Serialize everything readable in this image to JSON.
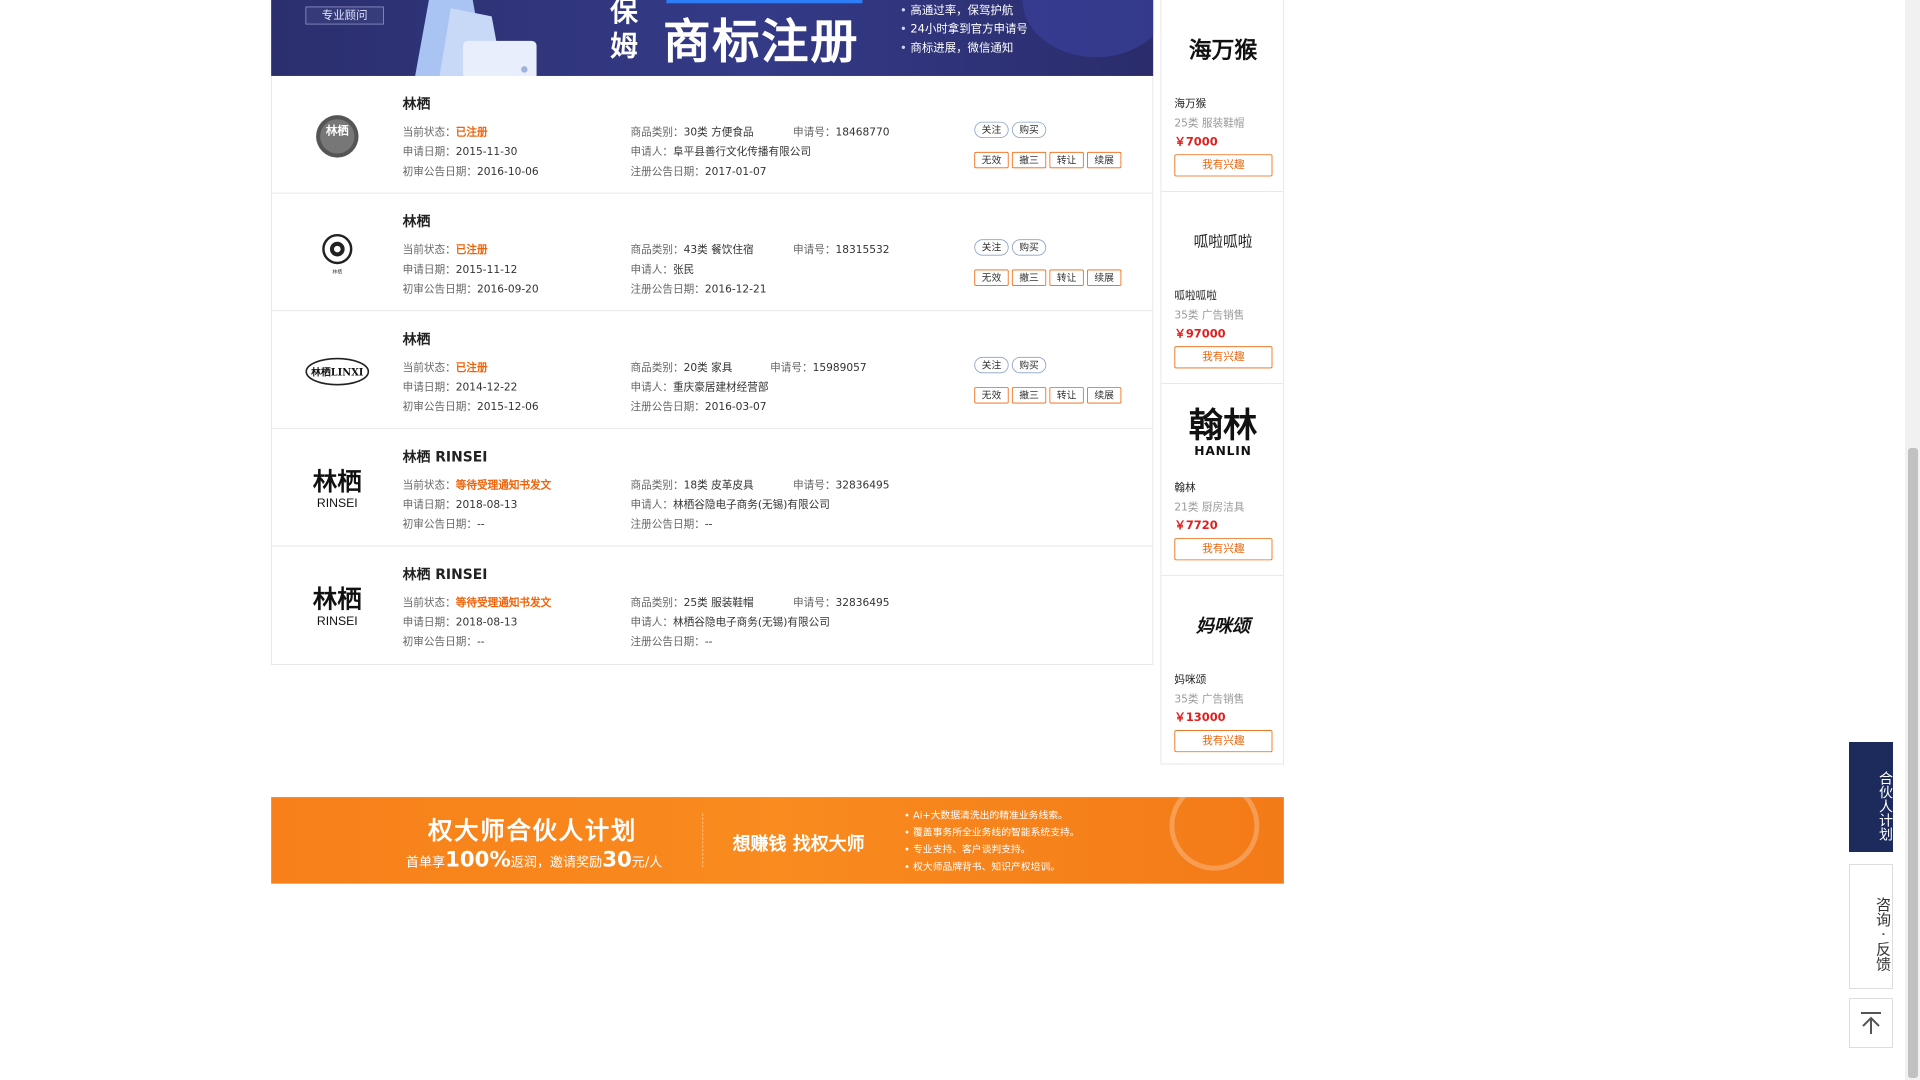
{
  "banner": {
    "consult_label": "专业顾问",
    "nanny": "保姆",
    "headline": "商标注册",
    "bullets": [
      "高通过率，保驾护航",
      "24小时拿到官方申请号",
      "商标进展，微信通知"
    ]
  },
  "labels": {
    "status": "当前状态：",
    "category": "商品类别：",
    "app_no": "申请号：",
    "app_date": "申请日期：",
    "applicant": "申请人：",
    "prelim_date": "初审公告日期：",
    "reg_date": "注册公告日期："
  },
  "actions": {
    "follow": "关注",
    "buy": "购买",
    "invalid": "无效",
    "revoke3": "撤三",
    "transfer": "转让",
    "renew": "续展"
  },
  "trademarks": [
    {
      "name": "林栖",
      "status": "已注册",
      "category": "30类 方便食品",
      "app_no": "18468770",
      "app_date": "2015-11-30",
      "applicant": "阜平县善行文化传播有限公司",
      "prelim_date": "2016-10-06",
      "reg_date": "2017-01-07",
      "logo_text": "林栖"
    },
    {
      "name": "林栖",
      "status": "已注册",
      "category": "43类 餐饮住宿",
      "app_no": "18315532",
      "app_date": "2015-11-12",
      "applicant": "张民",
      "prelim_date": "2016-09-20",
      "reg_date": "2016-12-21",
      "logo_text": "林栖"
    },
    {
      "name": "林栖",
      "status": "已注册",
      "category": "20类 家具",
      "app_no": "15989057",
      "app_date": "2014-12-22",
      "applicant": "重庆豪居建材经营部",
      "prelim_date": "2015-12-06",
      "reg_date": "2016-03-07",
      "logo_text": "林栖LINXI"
    },
    {
      "name": "林栖 RINSEI",
      "status": "等待受理通知书发文",
      "category": "18类 皮革皮具",
      "app_no": "32836495",
      "app_date": "2018-08-13",
      "applicant": "林栖谷隐电子商务(无锡)有限公司",
      "prelim_date": "--",
      "reg_date": "--",
      "logo_cn": "林栖",
      "logo_en": "RINSEI"
    },
    {
      "name": "林栖 RINSEI",
      "status": "等待受理通知书发文",
      "category": "25类 服装鞋帽",
      "app_no": "32836495",
      "app_date": "2018-08-13",
      "applicant": "林栖谷隐电子商务(无锡)有限公司",
      "prelim_date": "--",
      "reg_date": "--",
      "logo_cn": "林栖",
      "logo_en": "RINSEI"
    }
  ],
  "sidebar": {
    "interest_label": "我有兴趣",
    "items": [
      {
        "name": "海万猴",
        "category": "25类 服装鞋帽",
        "price": "￥7000",
        "logo": "海万猴"
      },
      {
        "name": "呱啦呱啦",
        "category": "35类 广告销售",
        "price": "￥97000",
        "logo": "呱啦呱啦"
      },
      {
        "name": "翰林",
        "category": "21类 厨房洁具",
        "price": "￥7720",
        "logo_cn": "翰林",
        "logo_en": "HANLIN"
      },
      {
        "name": "妈咪颂",
        "category": "35类 广告销售",
        "price": "￥13000",
        "logo": "妈咪颂"
      }
    ]
  },
  "footer": {
    "title": "权大师合伙人计划",
    "sub_pre": "首单享",
    "sub_pct": "100%",
    "sub_mid": "返润，邀请奖励",
    "sub_amt": "30",
    "sub_post": "元/人",
    "slogan": "想赚钱  找权大师",
    "bullets": [
      "Ai+大数据清洗出的精准业务线索。",
      "覆盖事务所全业务线的智能系统支持。",
      "专业支持、客户谈判支持。",
      "权大师品牌背书、知识产权培训。"
    ]
  },
  "floating": {
    "partner": "合伙人计划",
    "feedback": "咨询 · 反馈"
  }
}
